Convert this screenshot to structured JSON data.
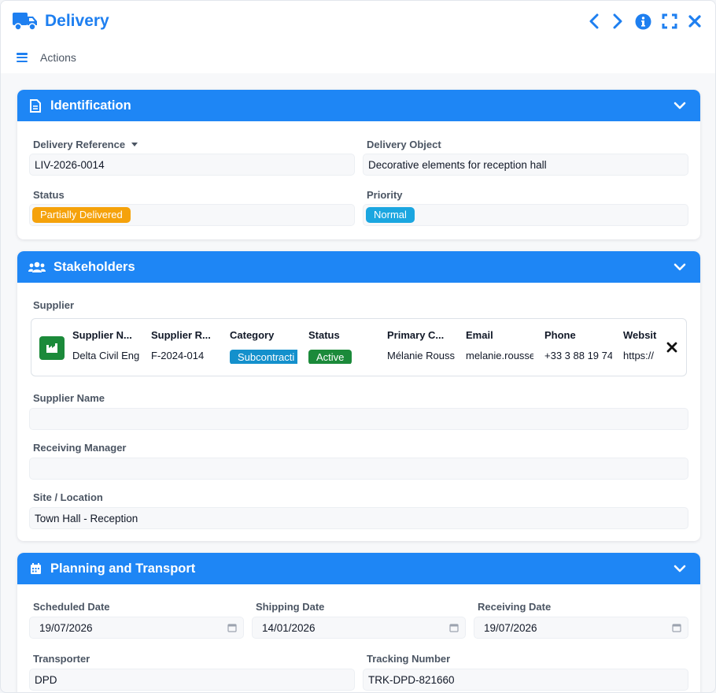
{
  "app": {
    "title": "Delivery",
    "actions_label": "Actions"
  },
  "colors": {
    "accent": "#1e86f5",
    "status_partial": "#f5a20b",
    "priority_normal": "#1ba6e0",
    "category_tag": "#1490cc",
    "active_tag": "#1b8a3a"
  },
  "sections": {
    "identification": {
      "title": "Identification",
      "reference_label": "Delivery Reference",
      "reference_value": "LIV-2026-0014",
      "object_label": "Delivery Object",
      "object_value": "Decorative elements for reception hall",
      "status_label": "Status",
      "status_value": "Partially Delivered",
      "priority_label": "Priority",
      "priority_value": "Normal"
    },
    "stakeholders": {
      "title": "Stakeholders",
      "supplier_label": "Supplier",
      "supplier_card": {
        "columns": [
          {
            "header": "Supplier N...",
            "value": "Delta Civil Eng"
          },
          {
            "header": "Supplier R...",
            "value": "F-2024-014"
          },
          {
            "header": "Category",
            "value": "Subcontracti"
          },
          {
            "header": "Status",
            "value": "Active"
          },
          {
            "header": "Primary C...",
            "value": "Mélanie Rouss"
          },
          {
            "header": "Email",
            "value": "melanie.rousse"
          },
          {
            "header": "Phone",
            "value": "+33 3 88 19 74"
          },
          {
            "header": "Websit",
            "value": "https://"
          }
        ]
      },
      "supplier_name_label": "Supplier Name",
      "supplier_name_value": "",
      "receiving_manager_label": "Receiving Manager",
      "receiving_manager_value": "",
      "site_label": "Site / Location",
      "site_value": "Town Hall - Reception"
    },
    "planning": {
      "title": "Planning and Transport",
      "scheduled_label": "Scheduled Date",
      "scheduled_value": "19/07/2026",
      "shipping_label": "Shipping Date",
      "shipping_value": "14/01/2026",
      "receiving_label": "Receiving Date",
      "receiving_value": "19/07/2026",
      "transporter_label": "Transporter",
      "transporter_value": "DPD",
      "tracking_label": "Tracking Number",
      "tracking_value": "TRK-DPD-821660"
    }
  },
  "icons": [
    "truck-icon",
    "chevron-left-icon",
    "chevron-right-icon",
    "info-icon",
    "fullscreen-icon",
    "close-icon",
    "hamburger-icon",
    "document-icon",
    "users-icon",
    "calendar-icon",
    "chevron-down-icon",
    "factory-icon",
    "x-icon"
  ]
}
